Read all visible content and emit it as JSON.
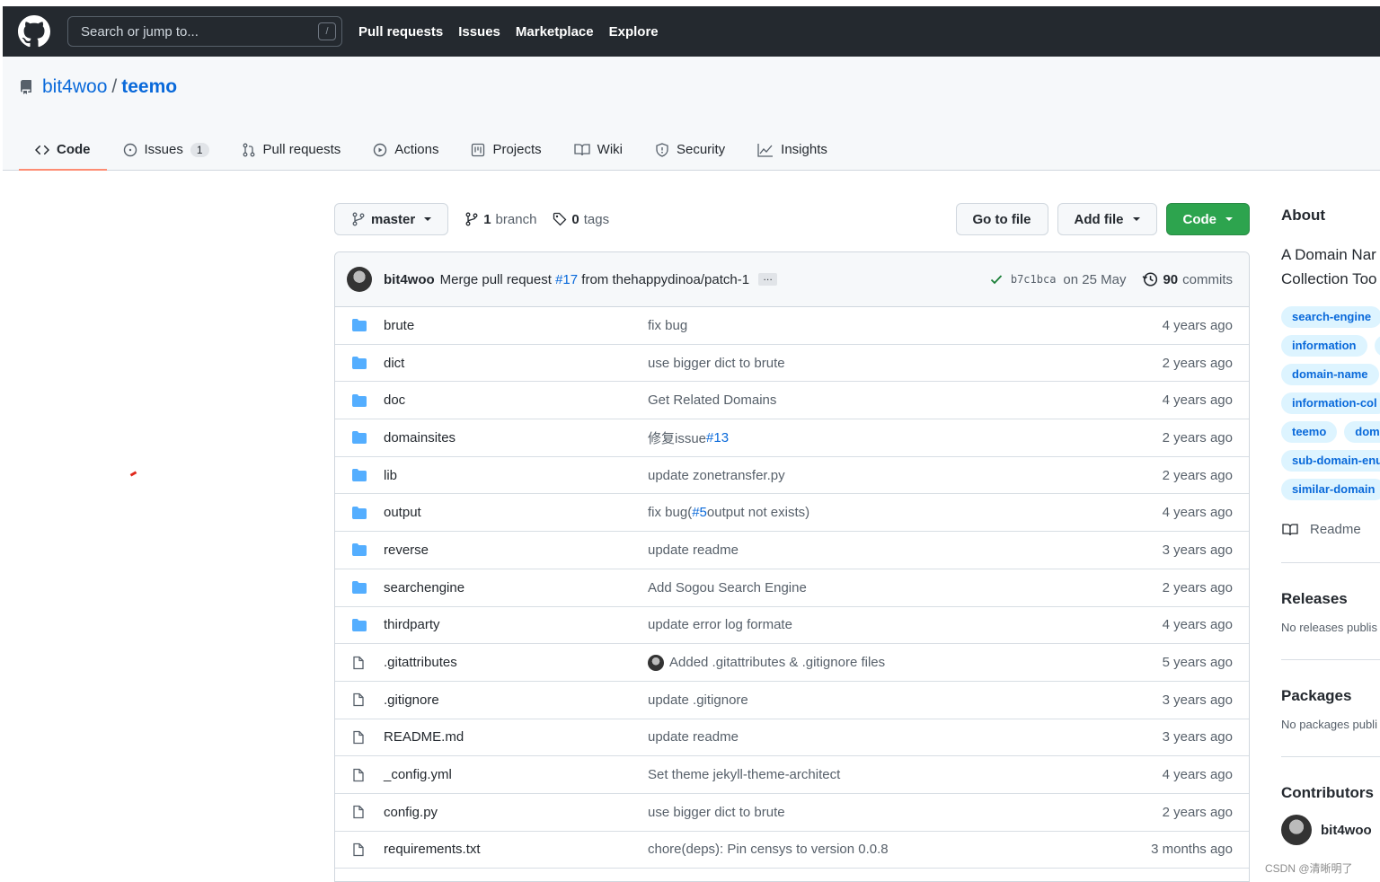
{
  "topbar": {
    "search_placeholder": "Search or jump to...",
    "search_shortcut": "/",
    "nav": [
      "Pull requests",
      "Issues",
      "Marketplace",
      "Explore"
    ]
  },
  "repo": {
    "owner": "bit4woo",
    "separator": "/",
    "name": "teemo"
  },
  "tabs": [
    {
      "label": "Code",
      "icon": "code-icon"
    },
    {
      "label": "Issues",
      "icon": "issue-icon",
      "count": "1"
    },
    {
      "label": "Pull requests",
      "icon": "pull-request-icon"
    },
    {
      "label": "Actions",
      "icon": "play-icon"
    },
    {
      "label": "Projects",
      "icon": "project-icon"
    },
    {
      "label": "Wiki",
      "icon": "book-icon"
    },
    {
      "label": "Security",
      "icon": "shield-icon"
    },
    {
      "label": "Insights",
      "icon": "graph-icon"
    }
  ],
  "filebar": {
    "branch": "master",
    "branch_count": "1",
    "branch_label": "branch",
    "tag_count": "0",
    "tag_label": "tags",
    "go_to_file": "Go to file",
    "add_file": "Add file",
    "code": "Code"
  },
  "latest_commit": {
    "author": "bit4woo",
    "message_pre": "Merge pull request",
    "pr": "#17",
    "message_post": "from thehappydinoa/patch-1",
    "ellipsis": "…",
    "sha": "b7c1bca",
    "date": "on 25 May",
    "commit_count": "90",
    "commit_label": "commits"
  },
  "files": [
    {
      "type": "dir",
      "name": "brute",
      "msg": "fix bug",
      "age": "4 years ago"
    },
    {
      "type": "dir",
      "name": "dict",
      "msg": "use bigger dict to brute",
      "age": "2 years ago"
    },
    {
      "type": "dir",
      "name": "doc",
      "msg": "Get Related Domains",
      "age": "4 years ago"
    },
    {
      "type": "dir",
      "name": "domainsites",
      "msg": "修复issue",
      "msg_link": "#13",
      "age": "2 years ago"
    },
    {
      "type": "dir",
      "name": "lib",
      "msg": "update zonetransfer.py",
      "age": "2 years ago"
    },
    {
      "type": "dir",
      "name": "output",
      "msg": "fix bug(",
      "msg_link": "#5",
      "msg_post": " output not exists)",
      "age": "4 years ago"
    },
    {
      "type": "dir",
      "name": "reverse",
      "msg": "update readme",
      "age": "3 years ago"
    },
    {
      "type": "dir",
      "name": "searchengine",
      "msg": "Add Sogou Search Engine",
      "age": "2 years ago"
    },
    {
      "type": "dir",
      "name": "thirdparty",
      "msg": "update error log formate",
      "age": "4 years ago"
    },
    {
      "type": "file",
      "name": ".gitattributes",
      "msg": "Added .gitattributes & .gitignore files",
      "avatar": true,
      "age": "5 years ago"
    },
    {
      "type": "file",
      "name": ".gitignore",
      "msg": "update .gitignore",
      "age": "3 years ago"
    },
    {
      "type": "file",
      "name": "README.md",
      "msg": "update readme",
      "age": "3 years ago"
    },
    {
      "type": "file",
      "name": "_config.yml",
      "msg": "Set theme jekyll-theme-architect",
      "age": "4 years ago"
    },
    {
      "type": "file",
      "name": "config.py",
      "msg": "use bigger dict to brute",
      "age": "2 years ago"
    },
    {
      "type": "file",
      "name": "requirements.txt",
      "msg": "chore(deps): Pin censys to version 0.0.8",
      "age": "3 months ago"
    }
  ],
  "sidebar": {
    "about_title": "About",
    "desc_line1": "A Domain Nar",
    "desc_line2": "Collection Too",
    "topic_rows": [
      [
        "search-engine"
      ],
      [
        "information",
        "i"
      ],
      [
        "domain-name"
      ],
      [
        "information-col"
      ],
      [
        "teemo",
        "dom"
      ],
      [
        "sub-domain-enu"
      ],
      [
        "similar-domain"
      ]
    ],
    "readme": "Readme",
    "releases_title": "Releases",
    "releases_sub": "No releases publis",
    "packages_title": "Packages",
    "packages_sub": "No packages publi",
    "contributors_title": "Contributors",
    "contributor": "bit4woo"
  },
  "watermark": "CSDN @清晰明了",
  "colors": {
    "topbar": "#24292f",
    "link": "#0969da",
    "green": "#2da44e",
    "folder": "#54aeff",
    "tab_underline": "#fd8c73"
  }
}
